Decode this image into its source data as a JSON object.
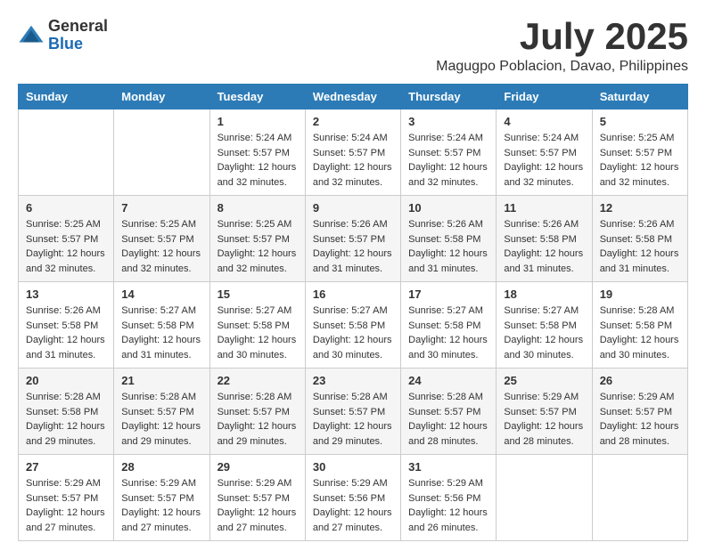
{
  "logo": {
    "general": "General",
    "blue": "Blue"
  },
  "title": "July 2025",
  "location": "Magugpo Poblacion, Davao, Philippines",
  "days_of_week": [
    "Sunday",
    "Monday",
    "Tuesday",
    "Wednesday",
    "Thursday",
    "Friday",
    "Saturday"
  ],
  "weeks": [
    [
      {
        "day": "",
        "sunrise": "",
        "sunset": "",
        "daylight": ""
      },
      {
        "day": "",
        "sunrise": "",
        "sunset": "",
        "daylight": ""
      },
      {
        "day": "1",
        "sunrise": "Sunrise: 5:24 AM",
        "sunset": "Sunset: 5:57 PM",
        "daylight": "Daylight: 12 hours and 32 minutes."
      },
      {
        "day": "2",
        "sunrise": "Sunrise: 5:24 AM",
        "sunset": "Sunset: 5:57 PM",
        "daylight": "Daylight: 12 hours and 32 minutes."
      },
      {
        "day": "3",
        "sunrise": "Sunrise: 5:24 AM",
        "sunset": "Sunset: 5:57 PM",
        "daylight": "Daylight: 12 hours and 32 minutes."
      },
      {
        "day": "4",
        "sunrise": "Sunrise: 5:24 AM",
        "sunset": "Sunset: 5:57 PM",
        "daylight": "Daylight: 12 hours and 32 minutes."
      },
      {
        "day": "5",
        "sunrise": "Sunrise: 5:25 AM",
        "sunset": "Sunset: 5:57 PM",
        "daylight": "Daylight: 12 hours and 32 minutes."
      }
    ],
    [
      {
        "day": "6",
        "sunrise": "Sunrise: 5:25 AM",
        "sunset": "Sunset: 5:57 PM",
        "daylight": "Daylight: 12 hours and 32 minutes."
      },
      {
        "day": "7",
        "sunrise": "Sunrise: 5:25 AM",
        "sunset": "Sunset: 5:57 PM",
        "daylight": "Daylight: 12 hours and 32 minutes."
      },
      {
        "day": "8",
        "sunrise": "Sunrise: 5:25 AM",
        "sunset": "Sunset: 5:57 PM",
        "daylight": "Daylight: 12 hours and 32 minutes."
      },
      {
        "day": "9",
        "sunrise": "Sunrise: 5:26 AM",
        "sunset": "Sunset: 5:57 PM",
        "daylight": "Daylight: 12 hours and 31 minutes."
      },
      {
        "day": "10",
        "sunrise": "Sunrise: 5:26 AM",
        "sunset": "Sunset: 5:58 PM",
        "daylight": "Daylight: 12 hours and 31 minutes."
      },
      {
        "day": "11",
        "sunrise": "Sunrise: 5:26 AM",
        "sunset": "Sunset: 5:58 PM",
        "daylight": "Daylight: 12 hours and 31 minutes."
      },
      {
        "day": "12",
        "sunrise": "Sunrise: 5:26 AM",
        "sunset": "Sunset: 5:58 PM",
        "daylight": "Daylight: 12 hours and 31 minutes."
      }
    ],
    [
      {
        "day": "13",
        "sunrise": "Sunrise: 5:26 AM",
        "sunset": "Sunset: 5:58 PM",
        "daylight": "Daylight: 12 hours and 31 minutes."
      },
      {
        "day": "14",
        "sunrise": "Sunrise: 5:27 AM",
        "sunset": "Sunset: 5:58 PM",
        "daylight": "Daylight: 12 hours and 31 minutes."
      },
      {
        "day": "15",
        "sunrise": "Sunrise: 5:27 AM",
        "sunset": "Sunset: 5:58 PM",
        "daylight": "Daylight: 12 hours and 30 minutes."
      },
      {
        "day": "16",
        "sunrise": "Sunrise: 5:27 AM",
        "sunset": "Sunset: 5:58 PM",
        "daylight": "Daylight: 12 hours and 30 minutes."
      },
      {
        "day": "17",
        "sunrise": "Sunrise: 5:27 AM",
        "sunset": "Sunset: 5:58 PM",
        "daylight": "Daylight: 12 hours and 30 minutes."
      },
      {
        "day": "18",
        "sunrise": "Sunrise: 5:27 AM",
        "sunset": "Sunset: 5:58 PM",
        "daylight": "Daylight: 12 hours and 30 minutes."
      },
      {
        "day": "19",
        "sunrise": "Sunrise: 5:28 AM",
        "sunset": "Sunset: 5:58 PM",
        "daylight": "Daylight: 12 hours and 30 minutes."
      }
    ],
    [
      {
        "day": "20",
        "sunrise": "Sunrise: 5:28 AM",
        "sunset": "Sunset: 5:58 PM",
        "daylight": "Daylight: 12 hours and 29 minutes."
      },
      {
        "day": "21",
        "sunrise": "Sunrise: 5:28 AM",
        "sunset": "Sunset: 5:57 PM",
        "daylight": "Daylight: 12 hours and 29 minutes."
      },
      {
        "day": "22",
        "sunrise": "Sunrise: 5:28 AM",
        "sunset": "Sunset: 5:57 PM",
        "daylight": "Daylight: 12 hours and 29 minutes."
      },
      {
        "day": "23",
        "sunrise": "Sunrise: 5:28 AM",
        "sunset": "Sunset: 5:57 PM",
        "daylight": "Daylight: 12 hours and 29 minutes."
      },
      {
        "day": "24",
        "sunrise": "Sunrise: 5:28 AM",
        "sunset": "Sunset: 5:57 PM",
        "daylight": "Daylight: 12 hours and 28 minutes."
      },
      {
        "day": "25",
        "sunrise": "Sunrise: 5:29 AM",
        "sunset": "Sunset: 5:57 PM",
        "daylight": "Daylight: 12 hours and 28 minutes."
      },
      {
        "day": "26",
        "sunrise": "Sunrise: 5:29 AM",
        "sunset": "Sunset: 5:57 PM",
        "daylight": "Daylight: 12 hours and 28 minutes."
      }
    ],
    [
      {
        "day": "27",
        "sunrise": "Sunrise: 5:29 AM",
        "sunset": "Sunset: 5:57 PM",
        "daylight": "Daylight: 12 hours and 27 minutes."
      },
      {
        "day": "28",
        "sunrise": "Sunrise: 5:29 AM",
        "sunset": "Sunset: 5:57 PM",
        "daylight": "Daylight: 12 hours and 27 minutes."
      },
      {
        "day": "29",
        "sunrise": "Sunrise: 5:29 AM",
        "sunset": "Sunset: 5:57 PM",
        "daylight": "Daylight: 12 hours and 27 minutes."
      },
      {
        "day": "30",
        "sunrise": "Sunrise: 5:29 AM",
        "sunset": "Sunset: 5:56 PM",
        "daylight": "Daylight: 12 hours and 27 minutes."
      },
      {
        "day": "31",
        "sunrise": "Sunrise: 5:29 AM",
        "sunset": "Sunset: 5:56 PM",
        "daylight": "Daylight: 12 hours and 26 minutes."
      },
      {
        "day": "",
        "sunrise": "",
        "sunset": "",
        "daylight": ""
      },
      {
        "day": "",
        "sunrise": "",
        "sunset": "",
        "daylight": ""
      }
    ]
  ]
}
